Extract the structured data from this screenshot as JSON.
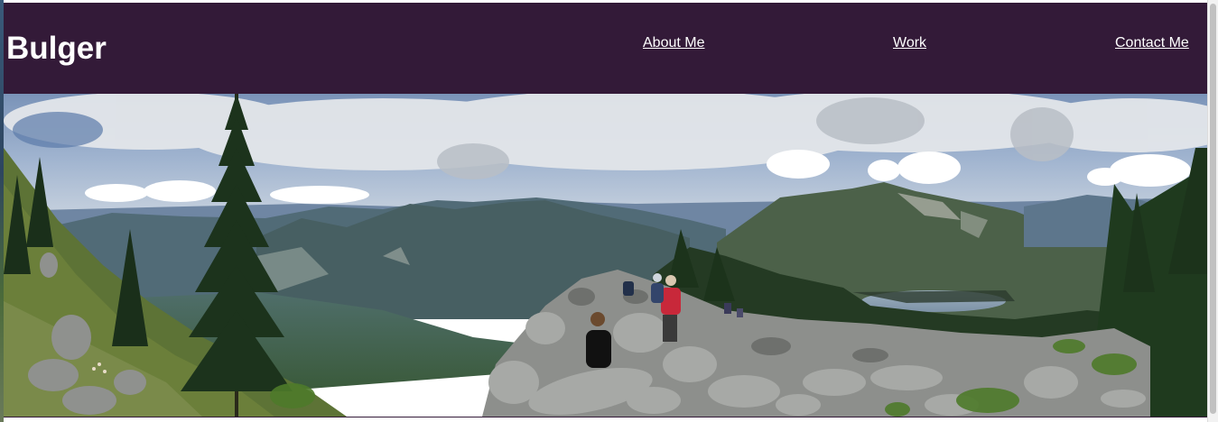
{
  "header": {
    "title": "Bulger",
    "background_color": "#331a38",
    "text_color": "#ffffff"
  },
  "nav": {
    "items": [
      {
        "label": "About Me"
      },
      {
        "label": "Work"
      },
      {
        "label": "Contact Me"
      }
    ]
  },
  "hero": {
    "image": "panoramic-mountain-photo",
    "alt": ""
  }
}
